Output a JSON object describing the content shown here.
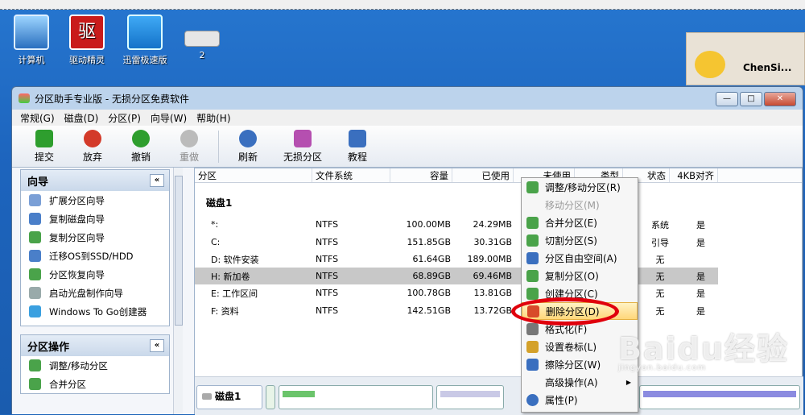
{
  "desktop": {
    "icons": [
      {
        "label": "计算机",
        "icon": "computer-icon"
      },
      {
        "label": "驱动精灵",
        "icon": "driver-genius-icon"
      },
      {
        "label": "迅雷极速版",
        "icon": "thunder-icon"
      },
      {
        "label": "2",
        "icon": "keyboard-icon"
      }
    ],
    "qq_name": "ChenSi..."
  },
  "window": {
    "title": "分区助手专业版 - 无损分区免费软件",
    "menu": [
      "常规(G)",
      "磁盘(D)",
      "分区(P)",
      "向导(W)",
      "帮助(H)"
    ],
    "toolbar": [
      {
        "label": "提交",
        "icon": "check-icon",
        "color": "#2e9e2e"
      },
      {
        "label": "放弃",
        "icon": "discard-icon",
        "color": "#d33a2a"
      },
      {
        "label": "撤销",
        "icon": "undo-icon",
        "color": "#2e9e2e"
      },
      {
        "label": "重做",
        "icon": "redo-icon",
        "color": "#9a9a9a"
      },
      {
        "label": "刷新",
        "icon": "refresh-icon",
        "color": "#3a6fbf"
      },
      {
        "label": "无损分区",
        "icon": "partition-icon",
        "color": "#b54fb0"
      },
      {
        "label": "教程",
        "icon": "tutorial-icon",
        "color": "#3a6fbf"
      }
    ]
  },
  "left": {
    "wizard_title": "向导",
    "wizard_items": [
      "扩展分区向导",
      "复制磁盘向导",
      "复制分区向导",
      "迁移OS到SSD/HDD",
      "分区恢复向导",
      "启动光盘制作向导",
      "Windows To Go创建器"
    ],
    "ops_title": "分区操作",
    "ops_items": [
      "调整/移动分区",
      "合并分区"
    ]
  },
  "table": {
    "headers": [
      "分区",
      "文件系统",
      "容量",
      "已使用",
      "未使用",
      "类型",
      "状态",
      "4KB对齐"
    ],
    "disk_label": "磁盘1",
    "rows": [
      {
        "name": "*:",
        "fs": "NTFS",
        "cap": "100.00MB",
        "used": "24.29MB",
        "status": "系统",
        "align": "是"
      },
      {
        "name": "C:",
        "fs": "NTFS",
        "cap": "151.85GB",
        "used": "30.31GB",
        "status": "引导",
        "align": "是"
      },
      {
        "name": "D: 软件安装",
        "fs": "NTFS",
        "cap": "61.64GB",
        "used": "189.00MB",
        "status": "无",
        "align": ""
      },
      {
        "name": "H: 新加卷",
        "fs": "NTFS",
        "cap": "68.89GB",
        "used": "69.46MB",
        "status": "无",
        "align": "是"
      },
      {
        "name": "E: 工作区间",
        "fs": "NTFS",
        "cap": "100.78GB",
        "used": "13.81GB",
        "status": "无",
        "align": "是"
      },
      {
        "name": "F: 资料",
        "fs": "NTFS",
        "cap": "142.51GB",
        "used": "13.72GB",
        "status": "无",
        "align": "是"
      }
    ],
    "bottom_disk": "磁盘1"
  },
  "context_menu": [
    {
      "label": "调整/移动分区(R)",
      "icon": "resize-icon",
      "state": "normal"
    },
    {
      "label": "移动分区(M)",
      "icon": "",
      "state": "disabled"
    },
    {
      "label": "合并分区(E)",
      "icon": "merge-icon",
      "state": "normal"
    },
    {
      "label": "切割分区(S)",
      "icon": "split-icon",
      "state": "normal"
    },
    {
      "label": "分区自由空间(A)",
      "icon": "allocate-icon",
      "state": "normal"
    },
    {
      "label": "复制分区(O)",
      "icon": "copy-icon",
      "state": "normal"
    },
    {
      "label": "创建分区(C)",
      "icon": "create-icon",
      "state": "normal"
    },
    {
      "label": "删除分区(D)",
      "icon": "delete-icon",
      "state": "highlight"
    },
    {
      "label": "格式化(F)",
      "icon": "format-icon",
      "state": "normal"
    },
    {
      "label": "设置卷标(L)",
      "icon": "label-icon",
      "state": "normal"
    },
    {
      "label": "擦除分区(W)",
      "icon": "wipe-icon",
      "state": "normal"
    },
    {
      "label": "高级操作(A)",
      "icon": "",
      "state": "submenu"
    },
    {
      "label": "属性(P)",
      "icon": "info-icon",
      "state": "normal"
    }
  ],
  "watermark": {
    "main": "Baidu经验",
    "sub": "jingyan.baidu.com"
  }
}
